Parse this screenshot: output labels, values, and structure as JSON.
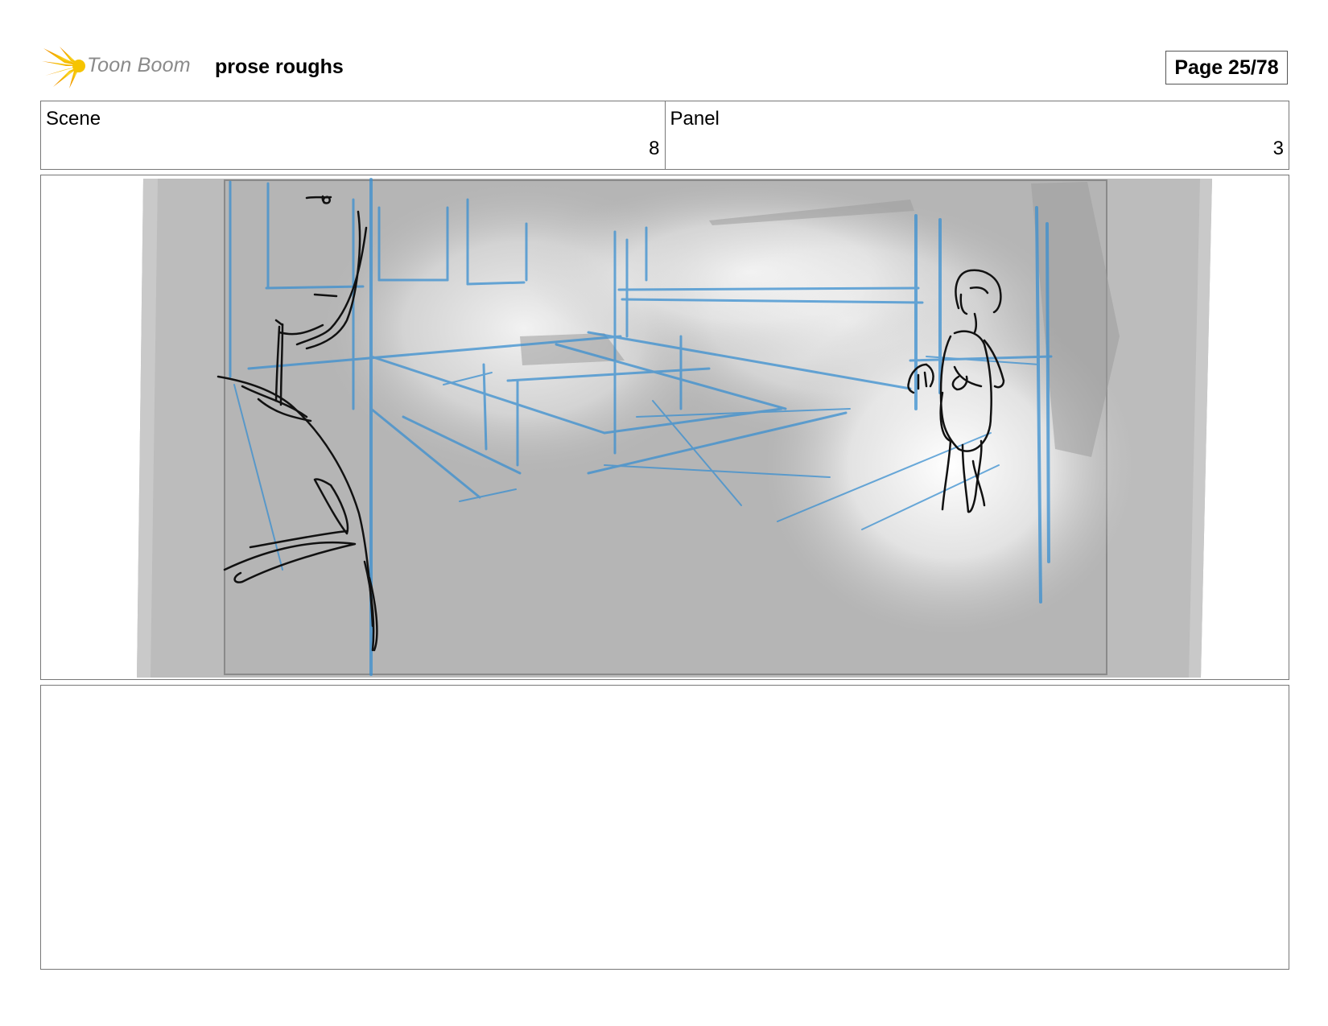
{
  "header": {
    "brand_name": "Toon Boom",
    "project_title": "prose roughs",
    "page_label": "Page 25/78"
  },
  "info": {
    "scene_label": "Scene",
    "scene_value": "8",
    "panel_label": "Panel",
    "panel_value": "3"
  },
  "notes": {
    "text": ""
  },
  "colors": {
    "brand_yellow": "#f6c400",
    "sketch_blue": "#3a8fd0",
    "frame_gray": "#777777"
  }
}
